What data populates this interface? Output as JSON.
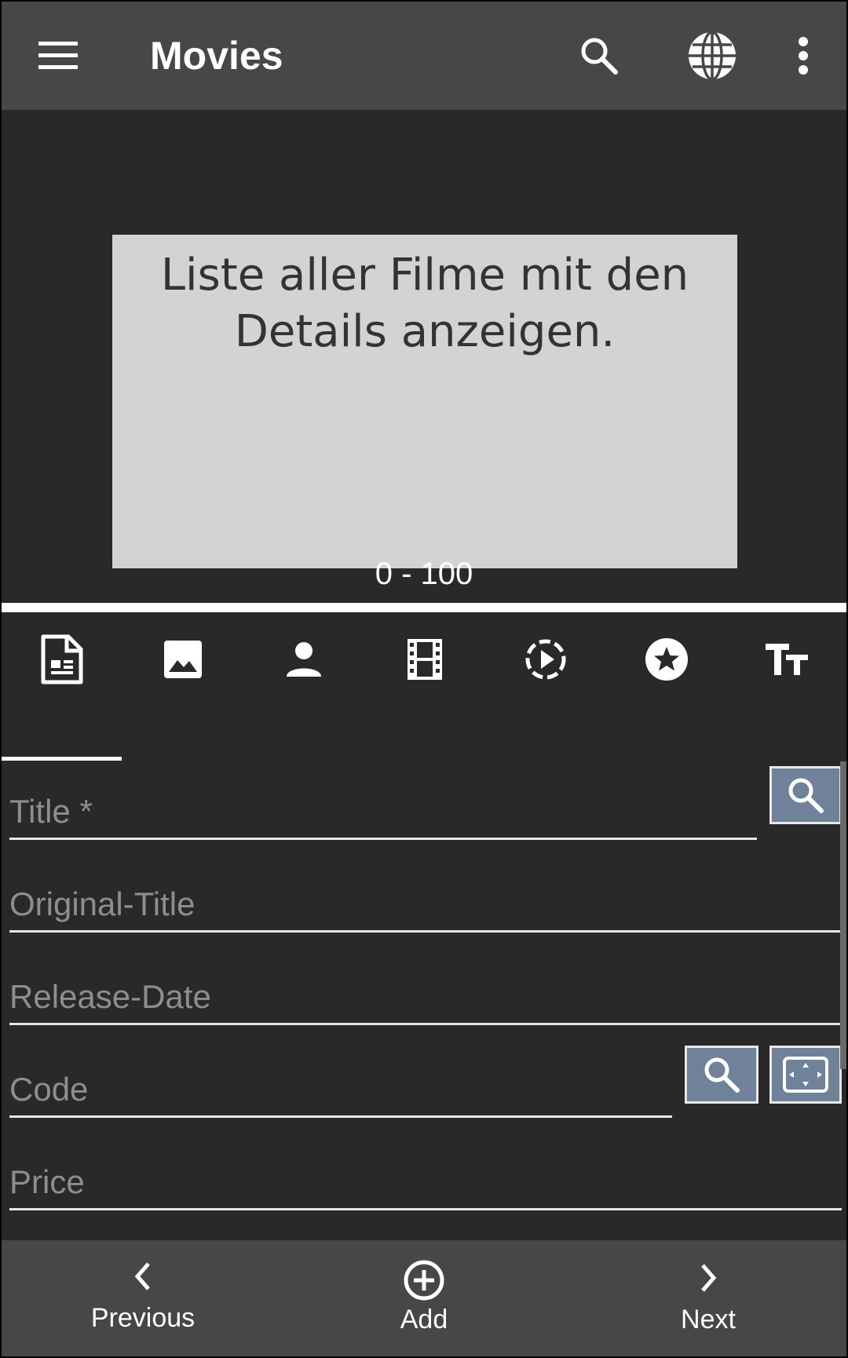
{
  "toolbar": {
    "title": "Movies",
    "icons": [
      "menu-icon",
      "search-icon",
      "globe-icon",
      "more-vert-icon"
    ]
  },
  "banner": {
    "text_line1": "Liste aller Filme mit den",
    "text_line2": "Details anzeigen.",
    "page_indicator": "0 - 100"
  },
  "tabs": [
    "document-icon",
    "image-icon",
    "person-icon",
    "film-icon",
    "play-circle-icon",
    "star-icon",
    "text-size-icon"
  ],
  "selected_tab": 0,
  "form": {
    "title_label": "Title *",
    "original_title_label": "Original-Title",
    "release_date_label": "Release-Date",
    "code_label": "Code",
    "price_label": "Price"
  },
  "bottom_nav": {
    "previous_label": "Previous",
    "add_label": "Add",
    "next_label": "Next"
  },
  "colors": {
    "toolbar_bg": "#474747",
    "content_bg": "#292929",
    "banner_bg": "#d3d3d3",
    "button_bg": "#70829a"
  }
}
